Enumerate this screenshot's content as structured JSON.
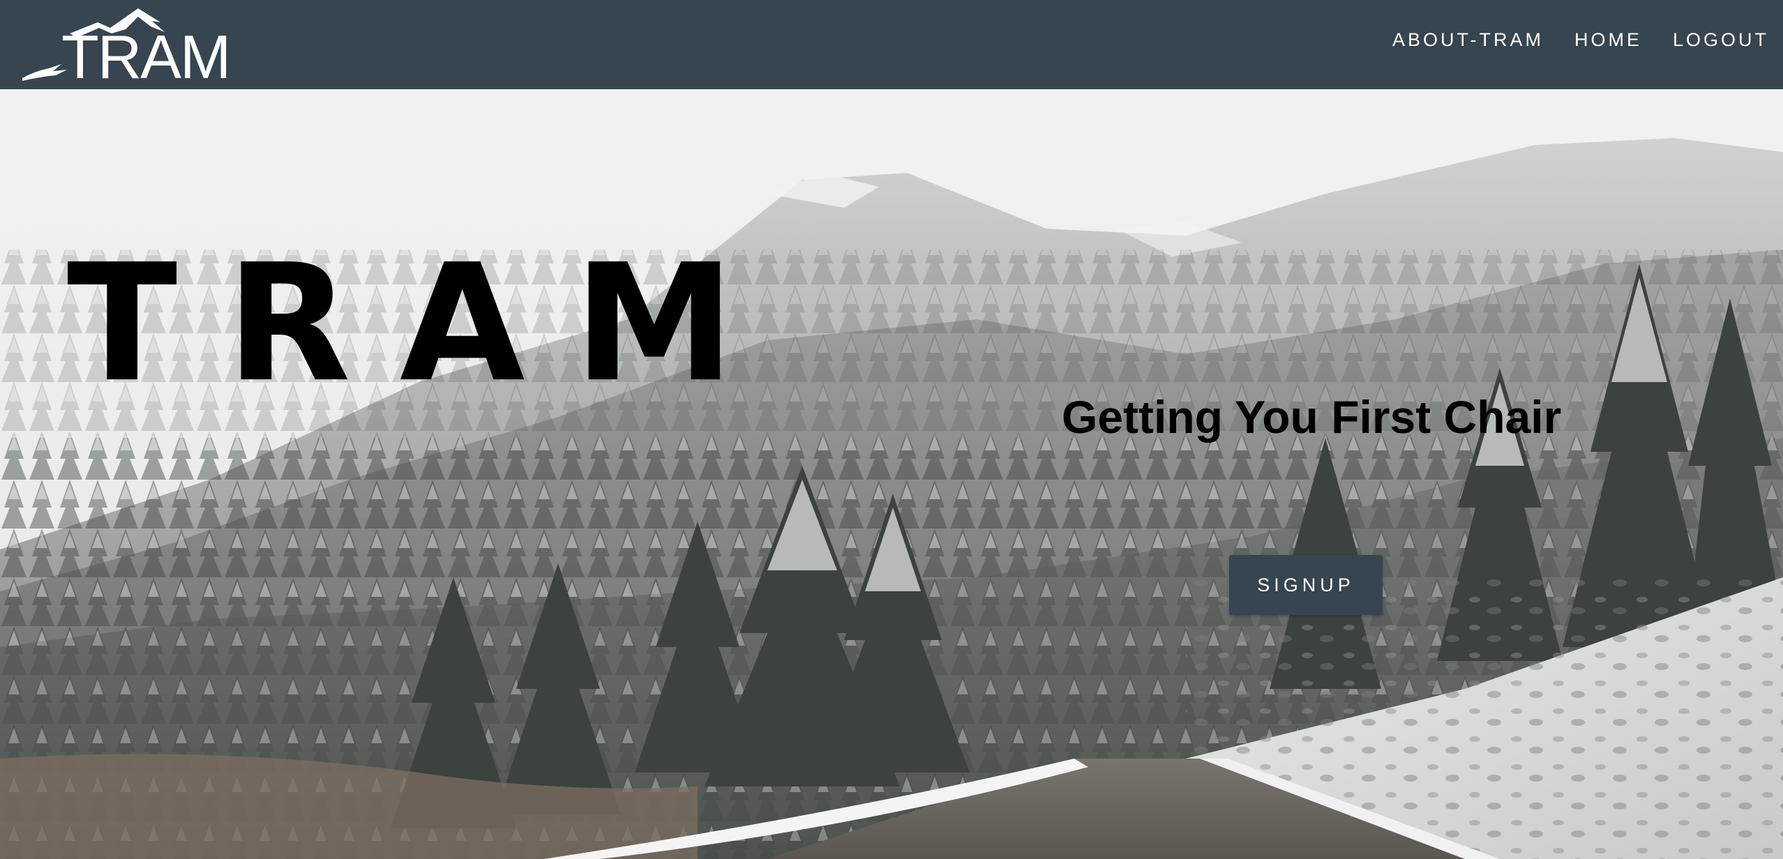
{
  "header": {
    "logo_text": "TRAM",
    "nav": [
      {
        "label": "ABOUT-TRAM"
      },
      {
        "label": "HOME"
      },
      {
        "label": "LOGOUT"
      }
    ]
  },
  "hero": {
    "title": "TRAM",
    "tagline": "Getting You First Chair",
    "signup_label": "SIGNUP",
    "background": "snowy-mountain-road-photo"
  },
  "colors": {
    "nav_bg": "#36454f",
    "nav_text": "#ffffff",
    "button_bg": "#36454f",
    "hero_text": "#000000"
  }
}
